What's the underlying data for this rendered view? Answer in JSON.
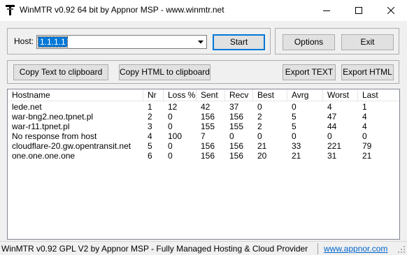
{
  "window": {
    "title": "WinMTR v0.92 64 bit by Appnor MSP - www.winmtr.net",
    "icon": "winmtr-app-icon"
  },
  "host": {
    "label": "Host:",
    "value": "1.1.1.1"
  },
  "buttons": {
    "start": "Start",
    "options": "Options",
    "exit": "Exit",
    "copy_text": "Copy Text to clipboard",
    "copy_html": "Copy HTML to clipboard",
    "export_text": "Export TEXT",
    "export_html": "Export HTML"
  },
  "table": {
    "columns": [
      "Hostname",
      "Nr",
      "Loss %",
      "Sent",
      "Recv",
      "Best",
      "Avrg",
      "Worst",
      "Last"
    ],
    "rows": [
      [
        "lede.net",
        "1",
        "12",
        "42",
        "37",
        "0",
        "0",
        "4",
        "1"
      ],
      [
        "war-bng2.neo.tpnet.pl",
        "2",
        "0",
        "156",
        "156",
        "2",
        "5",
        "47",
        "4"
      ],
      [
        "war-r11.tpnet.pl",
        "3",
        "0",
        "155",
        "155",
        "2",
        "5",
        "44",
        "4"
      ],
      [
        "No response from host",
        "4",
        "100",
        "7",
        "0",
        "0",
        "0",
        "0",
        "0"
      ],
      [
        "cloudflare-20.gw.opentransit.net",
        "5",
        "0",
        "156",
        "156",
        "21",
        "33",
        "221",
        "79"
      ],
      [
        "one.one.one.one",
        "6",
        "0",
        "156",
        "156",
        "20",
        "21",
        "31",
        "21"
      ]
    ]
  },
  "status": {
    "text": "WinMTR v0.92 GPL V2 by Appnor MSP - Fully Managed Hosting & Cloud Provider",
    "link": "www.appnor.com"
  },
  "colors": {
    "selection": "#0078d7",
    "link": "#0066cc",
    "dialog_bg": "#f0f0f0"
  }
}
